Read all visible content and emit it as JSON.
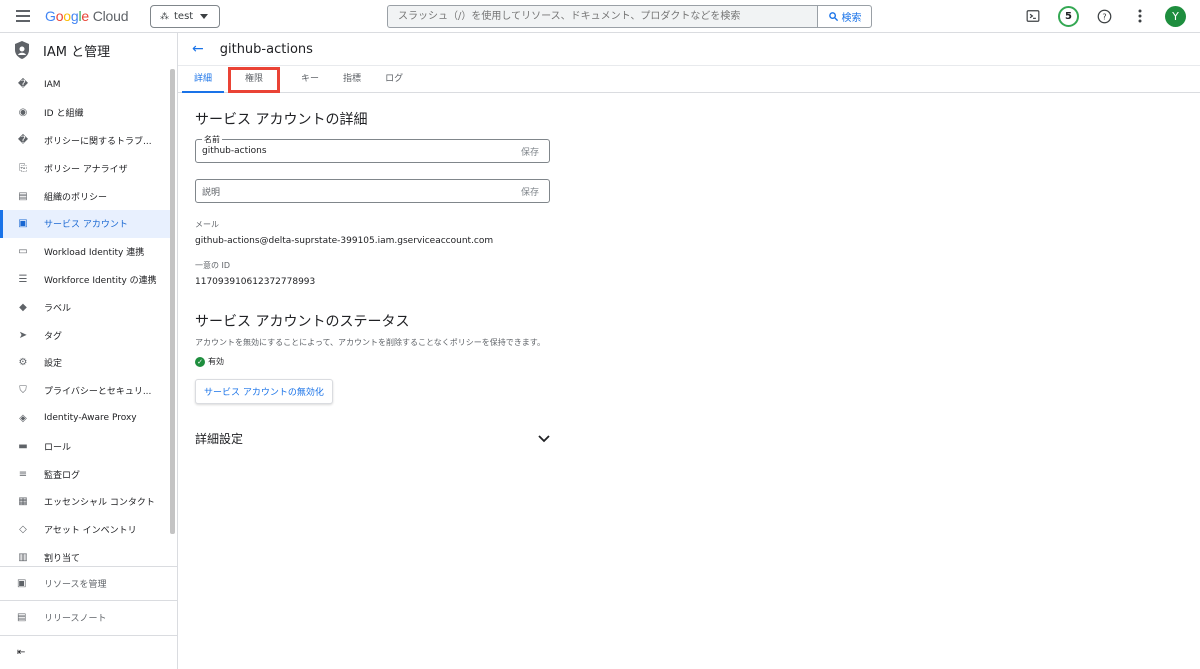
{
  "topbar": {
    "logo_google": "Google",
    "logo_cloud": "Cloud",
    "project": "test",
    "search_placeholder": "スラッシュ（/）を使用してリソース、ドキュメント、プロダクトなどを検索",
    "search_button": "検索",
    "notifications_count": "5",
    "avatar_letter": "Y"
  },
  "sidebar": {
    "title": "IAM と管理",
    "items": [
      {
        "label": "IAM",
        "icon": "person-add-icon"
      },
      {
        "label": "ID と組織",
        "icon": "account-circle-icon"
      },
      {
        "label": "ポリシーに関するトラブ...",
        "icon": "wrench-icon"
      },
      {
        "label": "ポリシー アナライザ",
        "icon": "analyzer-icon"
      },
      {
        "label": "組織のポリシー",
        "icon": "document-icon"
      },
      {
        "label": "サービス アカウント",
        "icon": "service-account-icon"
      },
      {
        "label": "Workload Identity 連携",
        "icon": "id-card-icon"
      },
      {
        "label": "Workforce Identity の連携",
        "icon": "list-icon"
      },
      {
        "label": "ラベル",
        "icon": "label-icon"
      },
      {
        "label": "タグ",
        "icon": "tag-icon"
      },
      {
        "label": "設定",
        "icon": "gear-icon"
      },
      {
        "label": "プライバシーとセキュリ...",
        "icon": "shield-icon"
      },
      {
        "label": "Identity-Aware Proxy",
        "icon": "proxy-icon"
      },
      {
        "label": "ロール",
        "icon": "hat-icon"
      },
      {
        "label": "監査ログ",
        "icon": "lines-icon"
      },
      {
        "label": "エッセンシャル コンタクト",
        "icon": "contact-icon"
      },
      {
        "label": "アセット インベントリ",
        "icon": "diamond-icon"
      },
      {
        "label": "割り当て",
        "icon": "quota-icon"
      }
    ],
    "active_index": 5,
    "footer_manage": "リソースを管理",
    "footer_release": "リリースノート",
    "collapse_icon": "collapse-icon"
  },
  "main": {
    "title": "github-actions",
    "tabs": [
      {
        "label": "詳細"
      },
      {
        "label": "権限"
      },
      {
        "label": "キー"
      },
      {
        "label": "指標"
      },
      {
        "label": "ログ"
      }
    ],
    "details_heading": "サービス アカウントの詳細",
    "name_label": "名前",
    "name_value": "github-actions",
    "save_label": "保存",
    "description_placeholder": "説明",
    "email_label": "メール",
    "email_value": "github-actions@delta-suprstate-399105.iam.gserviceaccount.com",
    "unique_id_label": "一意の ID",
    "unique_id_value": "117093910612372778993",
    "status_heading": "サービス アカウントのステータス",
    "status_description": "アカウントを無効にすることによって、アカウントを削除することなくポリシーを保持できます。",
    "status_value": "有効",
    "disable_button": "サービス アカウントの無効化",
    "advanced_heading": "詳細設定"
  },
  "colors": {
    "accent": "#1a73e8",
    "highlight_box": "#ea4335",
    "enabled_green": "#1e8e3e"
  }
}
